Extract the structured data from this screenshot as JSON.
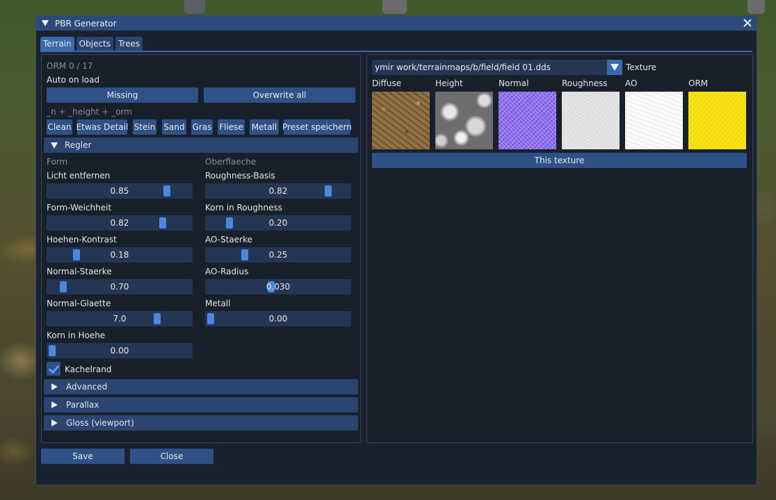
{
  "window": {
    "title": "PBR Generator"
  },
  "tabs": [
    {
      "label": "Terrain",
      "active": true
    },
    {
      "label": "Objects",
      "active": false
    },
    {
      "label": "Trees",
      "active": false
    }
  ],
  "left": {
    "orm_count": "ORM 0 / 17",
    "auto_on_load": "Auto on load",
    "missing_label": "Missing",
    "overwrite_label": "Overwrite all",
    "suffix_hint": "_n + _height + _orm",
    "presets": [
      "Clean",
      "Etwas Detail",
      "Stein",
      "Sand",
      "Gras",
      "Fliese",
      "Metall",
      "Preset speichern"
    ],
    "regler_header": "Regler",
    "form_heading": "Form",
    "surface_heading": "Oberflaeche",
    "form_sliders": [
      {
        "label": "Licht entfernen",
        "value": "0.85",
        "fraction": 0.85
      },
      {
        "label": "Form-Weichheit",
        "value": "0.82",
        "fraction": 0.82
      },
      {
        "label": "Hoehen-Kontrast",
        "value": "0.18",
        "fraction": 0.18
      },
      {
        "label": "Normal-Staerke",
        "value": "0.70",
        "fraction": 0.08
      },
      {
        "label": "Normal-Glaette",
        "value": "7.0",
        "fraction": 0.78
      },
      {
        "label": "Korn in Hoehe",
        "value": "0.00",
        "fraction": 0.0
      }
    ],
    "surface_sliders": [
      {
        "label": "Roughness-Basis",
        "value": "0.82",
        "fraction": 0.87
      },
      {
        "label": "Korn in Roughness",
        "value": "0.20",
        "fraction": 0.14
      },
      {
        "label": "AO-Staerke",
        "value": "0.25",
        "fraction": 0.25
      },
      {
        "label": "AO-Radius",
        "value": "0.030",
        "fraction": 0.45
      },
      {
        "label": "Metall",
        "value": "0.00",
        "fraction": 0.0
      }
    ],
    "kachelrand_label": "Kachelrand",
    "kachelrand_checked": true,
    "collapsed_headers": [
      "Advanced",
      "Parallax",
      "Gloss (viewport)"
    ]
  },
  "right": {
    "texture_path": "ymir work/terrainmaps/b/field/field 01.dds",
    "texture_label": "Texture",
    "maps": [
      "Diffuse",
      "Height",
      "Normal",
      "Roughness",
      "AO",
      "ORM"
    ],
    "this_texture_label": "This texture"
  },
  "footer": {
    "save_label": "Save",
    "close_label": "Close"
  }
}
